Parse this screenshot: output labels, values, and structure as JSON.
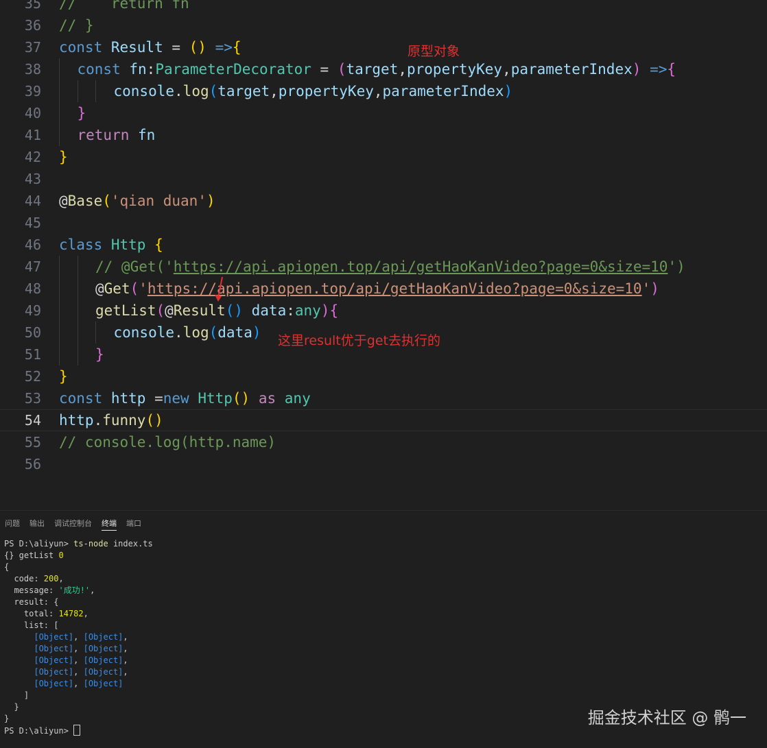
{
  "editor": {
    "lines": [
      {
        "n": "35",
        "indent": 0,
        "tokens": [
          [
            "cm",
            "//    return fn"
          ]
        ]
      },
      {
        "n": "36",
        "indent": 0,
        "tokens": [
          [
            "cm",
            "// }"
          ]
        ]
      },
      {
        "n": "37",
        "indent": 0,
        "tokens": [
          [
            "kw",
            "const "
          ],
          [
            "var",
            "Result"
          ],
          [
            "pun",
            " = "
          ],
          [
            "b1",
            "()"
          ],
          [
            "pun",
            " "
          ],
          [
            "kw",
            "=>"
          ],
          [
            "b1",
            "{"
          ]
        ]
      },
      {
        "n": "38",
        "indent": 1,
        "tokens": [
          [
            "kw",
            "const "
          ],
          [
            "var",
            "fn"
          ],
          [
            "pun",
            ":"
          ],
          [
            "type",
            "ParameterDecorator"
          ],
          [
            "pun",
            " = "
          ],
          [
            "b2",
            "("
          ],
          [
            "var",
            "target"
          ],
          [
            "pun",
            ","
          ],
          [
            "var",
            "propertyKey"
          ],
          [
            "pun",
            ","
          ],
          [
            "var",
            "parameterIndex"
          ],
          [
            "b2",
            ")"
          ],
          [
            "pun",
            " "
          ],
          [
            "kw",
            "=>"
          ],
          [
            "b2",
            "{"
          ]
        ]
      },
      {
        "n": "39",
        "indent": 3,
        "tokens": [
          [
            "var",
            "console"
          ],
          [
            "pun",
            "."
          ],
          [
            "fn",
            "log"
          ],
          [
            "b3",
            "("
          ],
          [
            "var",
            "target"
          ],
          [
            "pun",
            ","
          ],
          [
            "var",
            "propertyKey"
          ],
          [
            "pun",
            ","
          ],
          [
            "var",
            "parameterIndex"
          ],
          [
            "b3",
            ")"
          ]
        ]
      },
      {
        "n": "40",
        "indent": 1,
        "tokens": [
          [
            "b2",
            "}"
          ]
        ]
      },
      {
        "n": "41",
        "indent": 1,
        "tokens": [
          [
            "ctl",
            "return "
          ],
          [
            "var",
            "fn"
          ]
        ]
      },
      {
        "n": "42",
        "indent": 0,
        "tokens": [
          [
            "b1",
            "}"
          ]
        ]
      },
      {
        "n": "43",
        "indent": 0,
        "tokens": []
      },
      {
        "n": "44",
        "indent": 0,
        "tokens": [
          [
            "pun",
            "@"
          ],
          [
            "fn",
            "Base"
          ],
          [
            "b1",
            "("
          ],
          [
            "str",
            "'qian duan'"
          ],
          [
            "b1",
            ")"
          ]
        ]
      },
      {
        "n": "45",
        "indent": 0,
        "tokens": []
      },
      {
        "n": "46",
        "indent": 0,
        "tokens": [
          [
            "kw",
            "class "
          ],
          [
            "type",
            "Http"
          ],
          [
            "pun",
            " "
          ],
          [
            "b1",
            "{"
          ]
        ]
      },
      {
        "n": "47",
        "indent": 2,
        "tokens": [
          [
            "cm",
            "// @Get('"
          ],
          [
            "cmu",
            "https://api.apiopen.top/api/getHaoKanVideo?page=0&size=10"
          ],
          [
            "cm",
            "')"
          ]
        ]
      },
      {
        "n": "48",
        "indent": 2,
        "tokens": [
          [
            "pun",
            "@"
          ],
          [
            "fn",
            "Get"
          ],
          [
            "b2",
            "("
          ],
          [
            "str",
            "'"
          ],
          [
            "stru",
            "https://api.apiopen.top/api/getHaoKanVideo?page=0&size=10"
          ],
          [
            "str",
            "'"
          ],
          [
            "b2",
            ")"
          ]
        ]
      },
      {
        "n": "49",
        "indent": 2,
        "tokens": [
          [
            "fn",
            "getList"
          ],
          [
            "b2",
            "("
          ],
          [
            "pun",
            "@"
          ],
          [
            "fn",
            "Result"
          ],
          [
            "b3",
            "()"
          ],
          [
            "pun",
            " "
          ],
          [
            "var",
            "data"
          ],
          [
            "pun",
            ":"
          ],
          [
            "type",
            "any"
          ],
          [
            "b2",
            ")"
          ],
          [
            "b2",
            "{"
          ]
        ]
      },
      {
        "n": "50",
        "indent": 3,
        "tokens": [
          [
            "var",
            "console"
          ],
          [
            "pun",
            "."
          ],
          [
            "fn",
            "log"
          ],
          [
            "b3",
            "("
          ],
          [
            "var",
            "data"
          ],
          [
            "b3",
            ")"
          ]
        ]
      },
      {
        "n": "51",
        "indent": 2,
        "tokens": [
          [
            "b2",
            "}"
          ]
        ]
      },
      {
        "n": "52",
        "indent": 0,
        "tokens": [
          [
            "b1",
            "}"
          ]
        ]
      },
      {
        "n": "53",
        "indent": 0,
        "tokens": [
          [
            "kw",
            "const "
          ],
          [
            "var",
            "http"
          ],
          [
            "pun",
            " ="
          ],
          [
            "kw",
            "new "
          ],
          [
            "type",
            "Http"
          ],
          [
            "b1",
            "()"
          ],
          [
            "pun",
            " "
          ],
          [
            "ctl",
            "as "
          ],
          [
            "type",
            "any"
          ]
        ]
      },
      {
        "n": "54",
        "indent": 0,
        "tokens": [
          [
            "var",
            "http"
          ],
          [
            "pun",
            "."
          ],
          [
            "fn",
            "funny"
          ],
          [
            "b1",
            "()"
          ]
        ]
      },
      {
        "n": "55",
        "indent": 0,
        "tokens": [
          [
            "cm",
            "// console.log(http.name)"
          ]
        ]
      },
      {
        "n": "56",
        "indent": 0,
        "tokens": []
      }
    ],
    "active_line": "54",
    "annotation_prototype": "原型对象",
    "annotation_result": "这里result优于get去执行的"
  },
  "panel": {
    "tabs": [
      "问题",
      "输出",
      "调试控制台",
      "终端",
      "端口"
    ],
    "active_tab": "终端"
  },
  "terminal": {
    "lines": [
      [
        [
          "plain",
          "PS D:\\aliyun> "
        ],
        [
          "cmd",
          "ts-node"
        ],
        [
          "plain",
          " index.ts"
        ]
      ],
      [
        [
          "plain",
          "{} getList "
        ],
        [
          "yel",
          "0"
        ]
      ],
      [
        [
          "plain",
          "{"
        ]
      ],
      [
        [
          "plain",
          "  code: "
        ],
        [
          "yel",
          "200"
        ],
        [
          "plain",
          ","
        ]
      ],
      [
        [
          "plain",
          "  message: "
        ],
        [
          "str",
          "'成功!'"
        ],
        [
          "plain",
          ","
        ]
      ],
      [
        [
          "plain",
          "  result: {"
        ]
      ],
      [
        [
          "plain",
          "    total: "
        ],
        [
          "yel",
          "14782"
        ],
        [
          "plain",
          ","
        ]
      ],
      [
        [
          "plain",
          "    list: ["
        ]
      ],
      [
        [
          "plain",
          "      "
        ],
        [
          "obj",
          "[Object]"
        ],
        [
          "plain",
          ", "
        ],
        [
          "obj",
          "[Object]"
        ],
        [
          "plain",
          ","
        ]
      ],
      [
        [
          "plain",
          "      "
        ],
        [
          "obj",
          "[Object]"
        ],
        [
          "plain",
          ", "
        ],
        [
          "obj",
          "[Object]"
        ],
        [
          "plain",
          ","
        ]
      ],
      [
        [
          "plain",
          "      "
        ],
        [
          "obj",
          "[Object]"
        ],
        [
          "plain",
          ", "
        ],
        [
          "obj",
          "[Object]"
        ],
        [
          "plain",
          ","
        ]
      ],
      [
        [
          "plain",
          "      "
        ],
        [
          "obj",
          "[Object]"
        ],
        [
          "plain",
          ", "
        ],
        [
          "obj",
          "[Object]"
        ],
        [
          "plain",
          ","
        ]
      ],
      [
        [
          "plain",
          "      "
        ],
        [
          "obj",
          "[Object]"
        ],
        [
          "plain",
          ", "
        ],
        [
          "obj",
          "[Object]"
        ]
      ],
      [
        [
          "plain",
          "    ]"
        ]
      ],
      [
        [
          "plain",
          "  }"
        ]
      ],
      [
        [
          "plain",
          "}"
        ]
      ],
      [
        [
          "plain",
          "PS D:\\aliyun> "
        ],
        [
          "cursor",
          ""
        ]
      ]
    ]
  },
  "watermark": "掘金技术社区 @ 鹘一",
  "icons": {
    "arrow": "red-arrow-icon"
  }
}
